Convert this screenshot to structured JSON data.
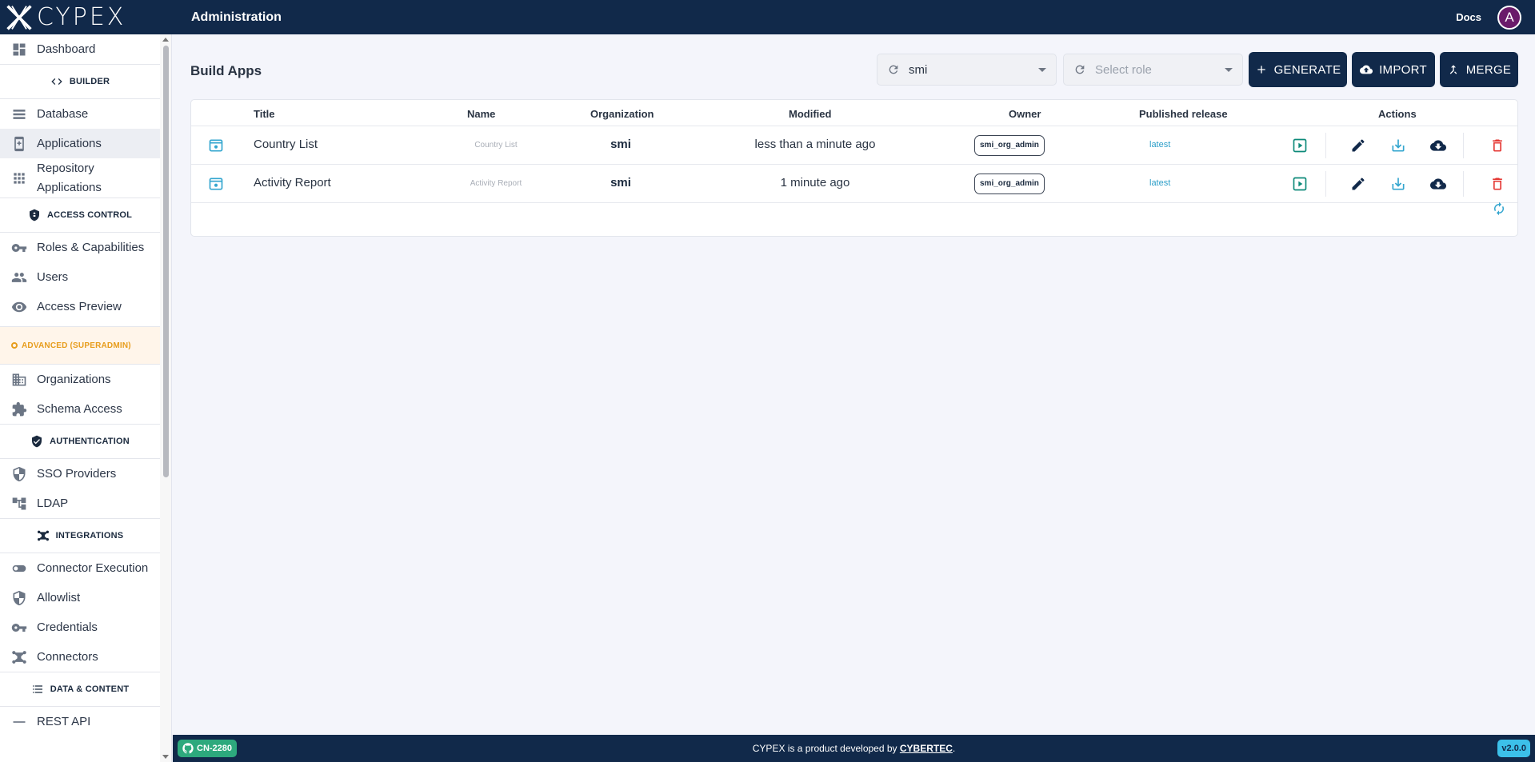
{
  "app": {
    "logo_text": "CYPEX",
    "title": "Administration",
    "docs_label": "Docs",
    "avatar_initial": "A"
  },
  "sidebar": {
    "dashboard": "Dashboard",
    "sec_builder": "BUILDER",
    "database": "Database",
    "applications": "Applications",
    "repo_line1": "Repository",
    "repo_line2": "Applications",
    "sec_access": "ACCESS CONTROL",
    "roles": "Roles & Capabilities",
    "users": "Users",
    "access_preview": "Access Preview",
    "sec_advanced": "ADVANCED (SUPERADMIN)",
    "organizations": "Organizations",
    "schema_access": "Schema Access",
    "sec_auth": "AUTHENTICATION",
    "sso": "SSO Providers",
    "ldap": "LDAP",
    "sec_integrations": "INTEGRATIONS",
    "connector_exec": "Connector Execution",
    "allowlist": "Allowlist",
    "credentials": "Credentials",
    "connectors": "Connectors",
    "sec_data": "DATA & CONTENT",
    "rest_api": "REST API"
  },
  "page": {
    "title": "Build Apps",
    "org_select_value": "smi",
    "role_select_placeholder": "Select role",
    "generate_label": "GENERATE",
    "import_label": "IMPORT",
    "merge_label": "MERGE"
  },
  "table": {
    "headers": {
      "title": "Title",
      "name": "Name",
      "organization": "Organization",
      "modified": "Modified",
      "owner": "Owner",
      "published": "Published release",
      "actions": "Actions"
    },
    "rows": [
      {
        "title": "Country List",
        "name": "Country List",
        "organization": "smi",
        "modified": "less than a minute ago",
        "owner": "smi_org_admin",
        "published": "latest"
      },
      {
        "title": "Activity Report",
        "name": "Activity Report",
        "organization": "smi",
        "modified": "1 minute ago",
        "owner": "smi_org_admin",
        "published": "latest"
      }
    ]
  },
  "footer": {
    "branch_badge": "CN-2280",
    "text_prefix": "CYPEX is a product developed by ",
    "company": "CYBERTEC",
    "text_suffix": ".",
    "version": "v2.0.0"
  },
  "colors": {
    "navy": "#11294a",
    "accent_blue": "#34a6cf",
    "green_action": "#0e8a7a",
    "delete_red": "#e53935",
    "advanced_orange": "#e79d1d"
  }
}
